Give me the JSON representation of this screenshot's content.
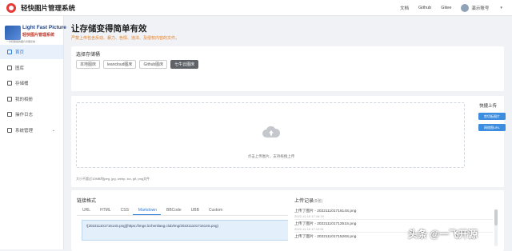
{
  "header": {
    "title": "轻快图片管理系统",
    "links": [
      "文档",
      "Github",
      "Gitee"
    ],
    "user": "演示账号"
  },
  "sidebar": {
    "brand_en": "Light Fast Picture",
    "brand_cn": "轻快图片管理系统",
    "brand_sub": "一款轻量级的图片管理系统",
    "items": [
      {
        "label": "首页",
        "active": true
      },
      {
        "label": "图库"
      },
      {
        "label": "存储桶"
      },
      {
        "label": "我的相册"
      },
      {
        "label": "操作日志"
      },
      {
        "label": "系统管理"
      }
    ]
  },
  "hero": {
    "title": "让存储变得简单有效",
    "subtitle": "严禁上传包含反动、暴力、色情、违法、及侵权内容的文件。"
  },
  "storage": {
    "title": "选择存储桶",
    "options": [
      "本地图床",
      "leancloud图床",
      "Github图床",
      "七牛云图床"
    ],
    "active_index": 3
  },
  "upload": {
    "drop_text": "点击上传图片，支持拖拽上传",
    "hint": "大小不超过10MB的jpeg, jpg, webp, ico, gif, png文件",
    "quick_title": "快捷上传",
    "quick_buttons": [
      "剪切板图片",
      "网络图URL"
    ]
  },
  "link_format": {
    "title": "链接格式",
    "tabs": [
      "URL",
      "HTML",
      "CSS",
      "Markdown",
      "BBCode",
      "UBB",
      "Custom"
    ],
    "active_tab": "Markdown",
    "output": "![20221110171614S.png](https://imgs.lzchenliang.club/img/20221110171614S.png)"
  },
  "records": {
    "title": "上传记录",
    "count": "(9张)",
    "items": [
      {
        "name": "上传了图片 - 20221110171614S.png",
        "time": "2022-11-10 17:16:15"
      },
      {
        "name": "上传了图片 - 20221110171251S.png",
        "time": "2022-11-10 17:12:51"
      },
      {
        "name": "上传了图片 - 20221110171526S.png",
        "time": ""
      }
    ]
  },
  "watermark": "头条 @一飞开源",
  "colors": {
    "accent": "#2f7bd5",
    "warning": "#e67e22",
    "active_bucket": "#5f6368"
  }
}
